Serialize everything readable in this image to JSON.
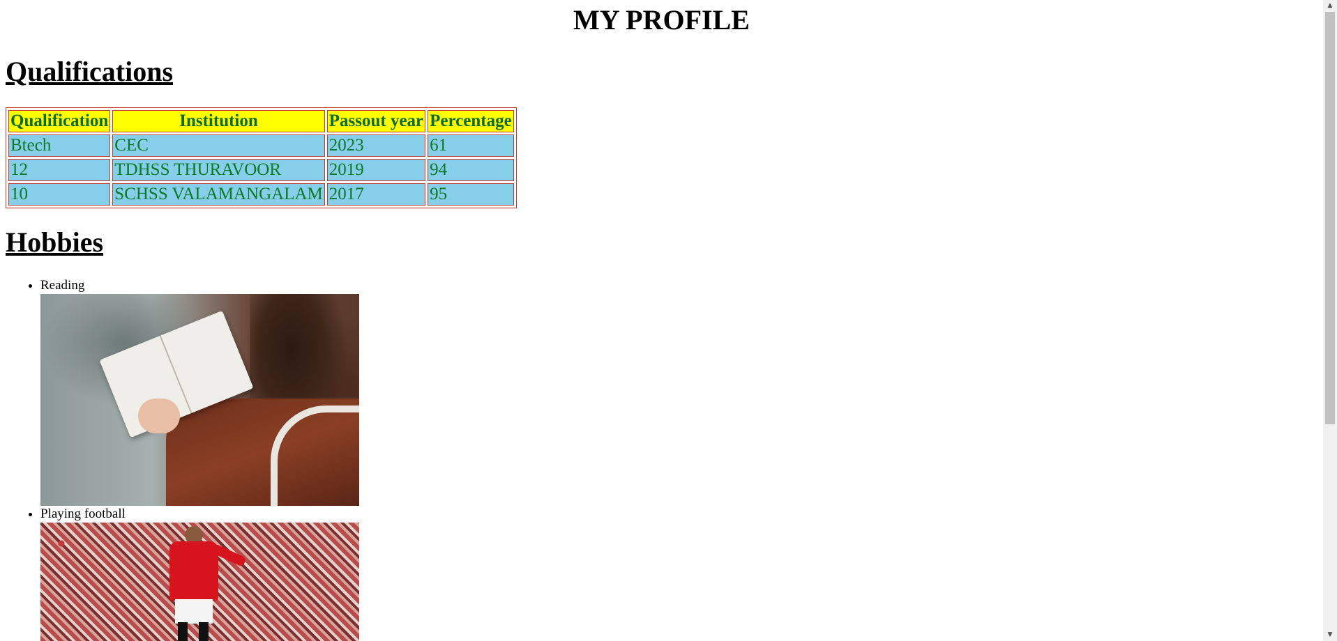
{
  "page": {
    "title": "MY PROFILE"
  },
  "qualifications": {
    "heading": "Qualifications",
    "columns": [
      "Qualification",
      "Institution",
      "Passout year",
      "Percentage"
    ],
    "rows": [
      [
        "Btech",
        "CEC",
        "2023",
        "61"
      ],
      [
        "12",
        "TDHSS THURAVOOR",
        "2019",
        "94"
      ],
      [
        "10",
        "SCHSS VALAMANGALAM",
        "2017",
        "95"
      ]
    ],
    "colors": {
      "header_bg": "#ffff00",
      "cell_bg": "#87ceeb",
      "text": "#0b7a26",
      "border": "#c0392b"
    }
  },
  "hobbies": {
    "heading": "Hobbies",
    "items": [
      {
        "label": "Reading",
        "image": "woman-reading-book-photo"
      },
      {
        "label": "Playing football",
        "image": "football-player-photo"
      }
    ]
  },
  "scrollbar": {
    "up_icon": "▲",
    "down_icon": "▼"
  }
}
